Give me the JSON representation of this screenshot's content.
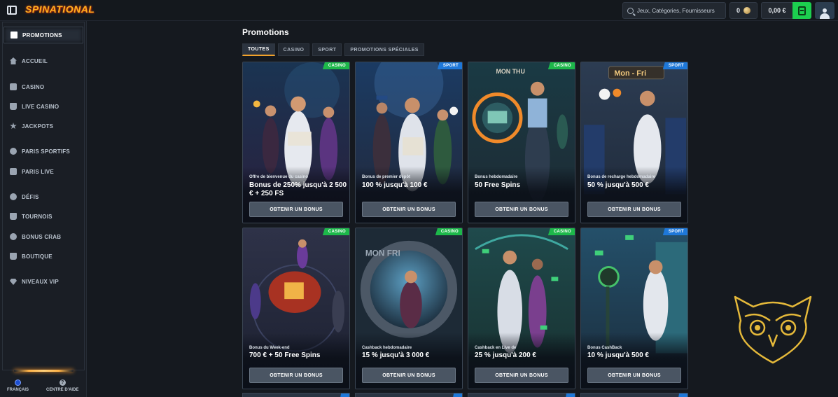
{
  "header": {
    "logo": "SPINATIONAL",
    "search_placeholder": "Jeux, Catégories, Fournisseurs",
    "coins": "0",
    "balance": "0,00 €"
  },
  "sidebar": {
    "items": [
      {
        "label": "PROMOTIONS",
        "icon": "gift-icon"
      },
      {
        "label": "ACCUEIL",
        "icon": "home-icon"
      },
      {
        "label": "CASINO",
        "icon": "casino-icon"
      },
      {
        "label": "LIVE CASINO",
        "icon": "live-casino-icon"
      },
      {
        "label": "JACKPOTS",
        "icon": "jackpot-icon"
      },
      {
        "label": "PARIS SPORTIFS",
        "icon": "football-icon"
      },
      {
        "label": "PARIS LIVE",
        "icon": "live-bet-icon"
      },
      {
        "label": "DÉFIS",
        "icon": "challenge-icon"
      },
      {
        "label": "TOURNOIS",
        "icon": "trophy-icon"
      },
      {
        "label": "BONUS CRAB",
        "icon": "crab-icon"
      },
      {
        "label": "BOUTIQUE",
        "icon": "shop-icon"
      },
      {
        "label": "NIVEAUX VIP",
        "icon": "diamond-icon"
      }
    ],
    "footer": {
      "language": "FRANÇAIS",
      "help": "CENTRE D'AIDE",
      "help_glyph": "?"
    }
  },
  "main": {
    "title": "Promotions",
    "tabs": [
      "TOUTES",
      "CASINO",
      "SPORT",
      "PROMOTIONS SPÉCIALES"
    ],
    "cards": [
      {
        "badge": "CASINO",
        "subtitle": "Offre de bienvenue du casino",
        "title": "Bonus de 250% jusqu'à 2 500 € + 250 FS",
        "button": "OBTENIR UN BONUS"
      },
      {
        "badge": "SPORT",
        "subtitle": "Bonus de premier dépôt",
        "title": "100 % jusqu'à 100 €",
        "button": "OBTENIR UN BONUS"
      },
      {
        "badge": "CASINO",
        "subtitle": "Bonus hebdomadaire",
        "title": "50 Free Spins",
        "button": "OBTENIR UN BONUS",
        "art_text": "MON THU"
      },
      {
        "badge": "SPORT",
        "subtitle": "Bonus de recharge hebdomadaire",
        "title": "50 % jusqu'à 500 €",
        "button": "OBTENIR UN BONUS",
        "art_text": "Mon - Fri"
      },
      {
        "badge": "CASINO",
        "subtitle": "Bonus du Week-end",
        "title": "700 € + 50 Free Spins",
        "button": "OBTENIR UN BONUS"
      },
      {
        "badge": "CASINO",
        "subtitle": "Cashback hebdomadaire",
        "title": "15 % jusqu'à 3 000 €",
        "button": "OBTENIR UN BONUS",
        "art_text": "MON FRI"
      },
      {
        "badge": "CASINO",
        "subtitle": "Cashback en Live de",
        "title": "25 % jusqu'à 200 €",
        "button": "OBTENIR UN BONUS"
      },
      {
        "badge": "SPORT",
        "subtitle": "Bonus CashBack",
        "title": "10 % jusqu'à 500 €",
        "button": "OBTENIR UN BONUS"
      }
    ]
  },
  "colors": {
    "casino_badge": "#1db84a",
    "sport_badge": "#1e78d9",
    "wallet_button": "#1ccf4f",
    "active_tab_underline": "#f2a22a",
    "owl_watermark": "#e5b93a"
  }
}
